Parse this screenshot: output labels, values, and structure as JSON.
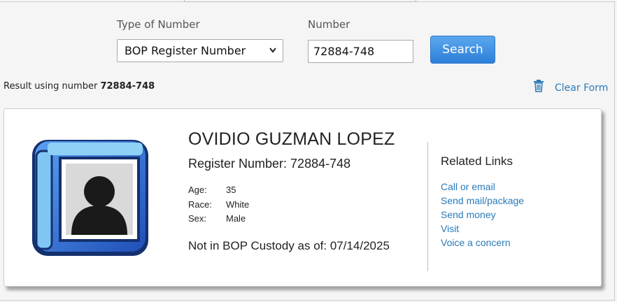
{
  "form": {
    "type_label": "Type of Number",
    "type_selected": "BOP Register Number",
    "number_label": "Number",
    "number_value": "72884-748",
    "search_label": "Search"
  },
  "result": {
    "prefix": "Result using number",
    "number": "72884-748",
    "clear_label": "Clear Form"
  },
  "inmate": {
    "name": "OVIDIO GUZMAN LOPEZ",
    "register_line": "Register Number: 72884-748",
    "age_label": "Age:",
    "age": "35",
    "race_label": "Race:",
    "race": "White",
    "sex_label": "Sex:",
    "sex": "Male",
    "custody_status": "Not in BOP Custody as of: 07/14/2025"
  },
  "related": {
    "title": "Related Links",
    "links": [
      "Call or email",
      "Send mail/package",
      "Send money",
      "Visit",
      "Voice a concern"
    ]
  },
  "icons": {
    "trash": "trash-icon",
    "avatar": "person-silhouette-icon",
    "dropdown": "chevron-down-icon"
  },
  "colors": {
    "link": "#2a7ab8",
    "button": "#2c7fd8",
    "avatar_frame": "#2f6fd6"
  }
}
